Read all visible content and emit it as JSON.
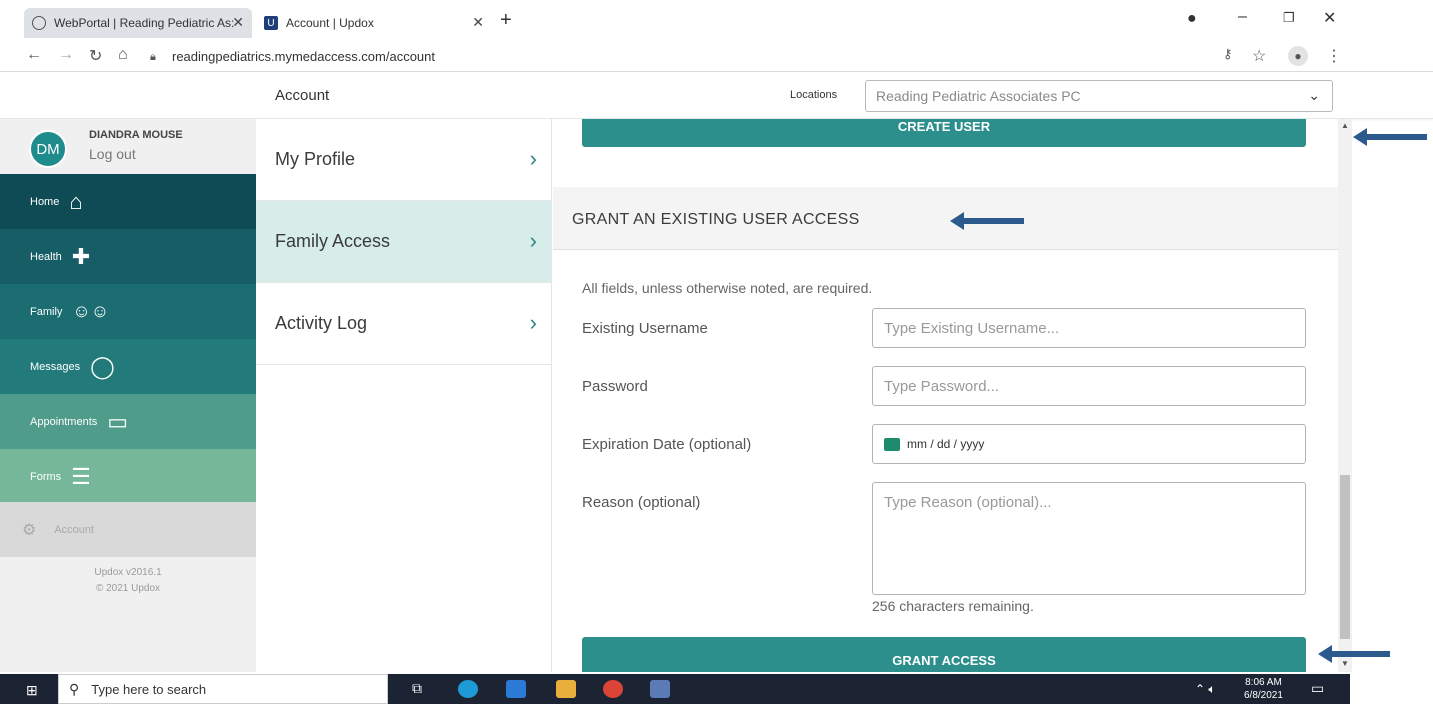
{
  "browser": {
    "tabs": [
      {
        "label": "WebPortal | Reading Pediatric As:",
        "close": "✕"
      },
      {
        "label": "Account | Updox",
        "close": "✕"
      }
    ],
    "new_tab": "+",
    "url": "readingpediatrics.mymedaccess.com/account"
  },
  "header": {
    "title": "Account",
    "locations_label": "Locations",
    "location_value": "Reading Pediatric Associates PC"
  },
  "sidebar": {
    "user": {
      "initials": "DM",
      "name": "DIANDRA MOUSE",
      "logout": "Log out"
    },
    "items": [
      {
        "label": "Home",
        "icon": "home-icon",
        "color": "#0f4b55"
      },
      {
        "label": "Health",
        "icon": "health-cross-icon",
        "color": "#165d66"
      },
      {
        "label": "Family",
        "icon": "family-icon",
        "color": "#1b6d72"
      },
      {
        "label": "Messages",
        "icon": "message-bubble-icon",
        "color": "#237a7a"
      },
      {
        "label": "Appointments",
        "icon": "calendar-icon",
        "color": "#4f9c8a"
      },
      {
        "label": "Forms",
        "icon": "forms-icon",
        "color": "#76b79a"
      }
    ],
    "account_label": "Account",
    "version": "Updox v2016.1",
    "copyright": "© 2021 Updox"
  },
  "menu": {
    "items": [
      {
        "label": "My Profile",
        "selected": false
      },
      {
        "label": "Family Access",
        "selected": true
      },
      {
        "label": "Activity Log",
        "selected": false
      }
    ]
  },
  "main": {
    "create_button": "CREATE USER",
    "section_title": "GRANT AN EXISTING USER ACCESS",
    "note": "All fields, unless otherwise noted, are required.",
    "fields": {
      "username_label": "Existing Username",
      "username_placeholder": "Type Existing Username...",
      "password_label": "Password",
      "password_placeholder": "Type Password...",
      "expiration_label": "Expiration Date (optional)",
      "expiration_placeholder": "mm / dd / yyyy",
      "reason_label": "Reason (optional)",
      "reason_placeholder": "Type Reason (optional)..."
    },
    "remaining": "256 characters remaining.",
    "grant_button": "GRANT ACCESS"
  },
  "taskbar": {
    "search_placeholder": "Type here to search",
    "time": "8:06 AM",
    "date": "6/8/2021"
  },
  "colors": {
    "accent": "#2c8f8c",
    "annotation": "#2d5a8e"
  }
}
